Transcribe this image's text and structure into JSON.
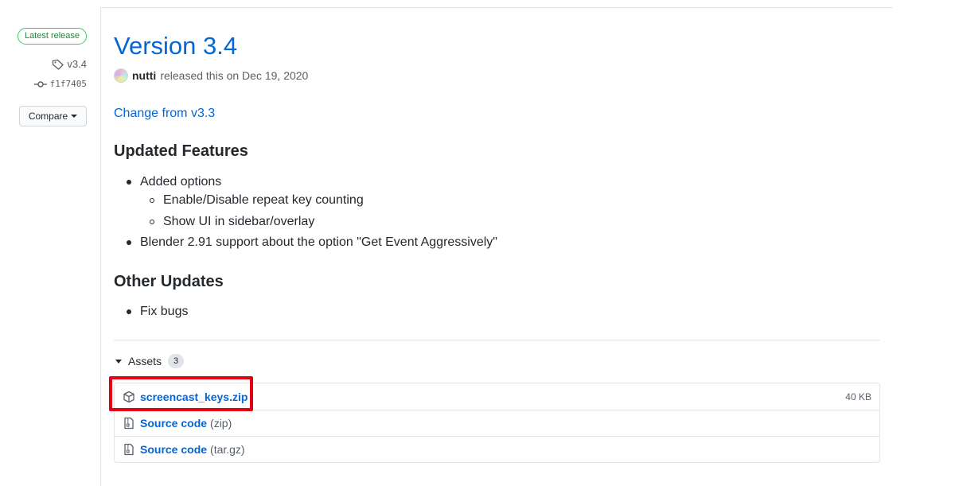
{
  "release": {
    "badge": "Latest release",
    "tag": "v3.4",
    "commit": "f1f7405",
    "compare_label": "Compare",
    "title": "Version 3.4",
    "author": "nutti",
    "released_text": "released this on Dec 19, 2020"
  },
  "body": {
    "change_link": "Change from v3.3",
    "updated_heading": "Updated Features",
    "updated_items": {
      "added_options": "Added options",
      "sub1": "Enable/Disable repeat key counting",
      "sub2": "Show UI in sidebar/overlay",
      "blender": "Blender 2.91 support about the option \"Get Event Aggressively\""
    },
    "other_heading": "Other Updates",
    "other_items": [
      "Fix bugs"
    ]
  },
  "assets": {
    "label": "Assets",
    "count": "3",
    "items": [
      {
        "name": "screencast_keys.zip",
        "suffix": "",
        "size": "40 KB",
        "icon": "package-icon"
      },
      {
        "name": "Source code",
        "suffix": "(zip)",
        "size": "",
        "icon": "file-zip-icon"
      },
      {
        "name": "Source code",
        "suffix": "(tar.gz)",
        "size": "",
        "icon": "file-zip-icon"
      }
    ]
  },
  "colors": {
    "link": "#0366d6",
    "badge_green": "#22863a",
    "highlight_red": "#e0000f"
  }
}
